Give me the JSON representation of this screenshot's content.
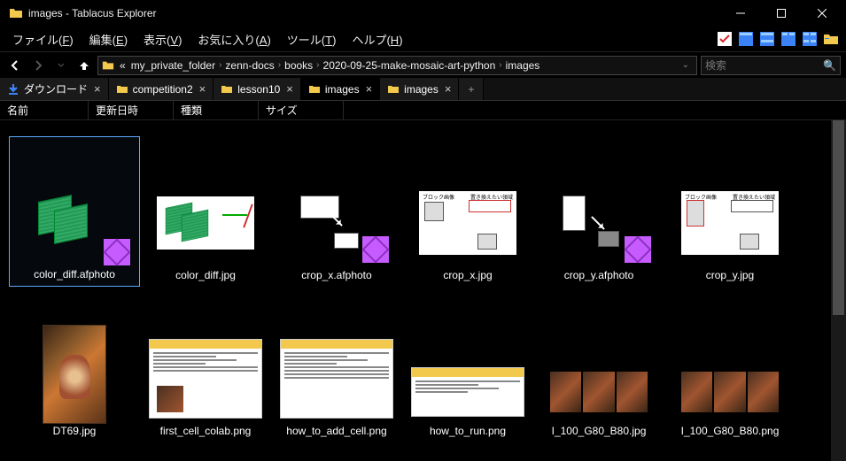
{
  "window": {
    "title": "images - Tablacus Explorer"
  },
  "menu": {
    "items": [
      {
        "label": "ファイル",
        "accel": "F"
      },
      {
        "label": "編集",
        "accel": "E"
      },
      {
        "label": "表示",
        "accel": "V"
      },
      {
        "label": "お気に入り",
        "accel": "A"
      },
      {
        "label": "ツール",
        "accel": "T"
      },
      {
        "label": "ヘルプ",
        "accel": "H"
      }
    ]
  },
  "breadcrumb": {
    "prefix": "«",
    "parts": [
      "my_private_folder",
      "zenn-docs",
      "books",
      "2020-09-25-make-mosaic-art-python",
      "images"
    ]
  },
  "search": {
    "placeholder": "検索"
  },
  "tabs": [
    {
      "label": "ダウンロード",
      "icon": "download",
      "active": false
    },
    {
      "label": "competition2",
      "icon": "folder",
      "active": false
    },
    {
      "label": "lesson10",
      "icon": "folder",
      "active": false
    },
    {
      "label": "images",
      "icon": "folder",
      "active": true
    },
    {
      "label": "images",
      "icon": "folder",
      "active": false
    }
  ],
  "columns": [
    "名前",
    "更新日時",
    "種類",
    "サイズ"
  ],
  "files": [
    {
      "name": "color_diff.afphoto",
      "kind": "afphoto-grid",
      "selected": true
    },
    {
      "name": "color_diff.jpg",
      "kind": "jpg-grid"
    },
    {
      "name": "crop_x.afphoto",
      "kind": "afphoto-cropx"
    },
    {
      "name": "crop_x.jpg",
      "kind": "jpg-cropx"
    },
    {
      "name": "crop_y.afphoto",
      "kind": "afphoto-cropy"
    },
    {
      "name": "crop_y.jpg",
      "kind": "jpg-cropy"
    },
    {
      "name": "DT69.jpg",
      "kind": "painting"
    },
    {
      "name": "first_cell_colab.png",
      "kind": "code1"
    },
    {
      "name": "how_to_add_cell.png",
      "kind": "code2"
    },
    {
      "name": "how_to_run.png",
      "kind": "code3"
    },
    {
      "name": "I_100_G80_B80.jpg",
      "kind": "triple"
    },
    {
      "name": "I_100_G80_B80.png",
      "kind": "triple"
    }
  ]
}
